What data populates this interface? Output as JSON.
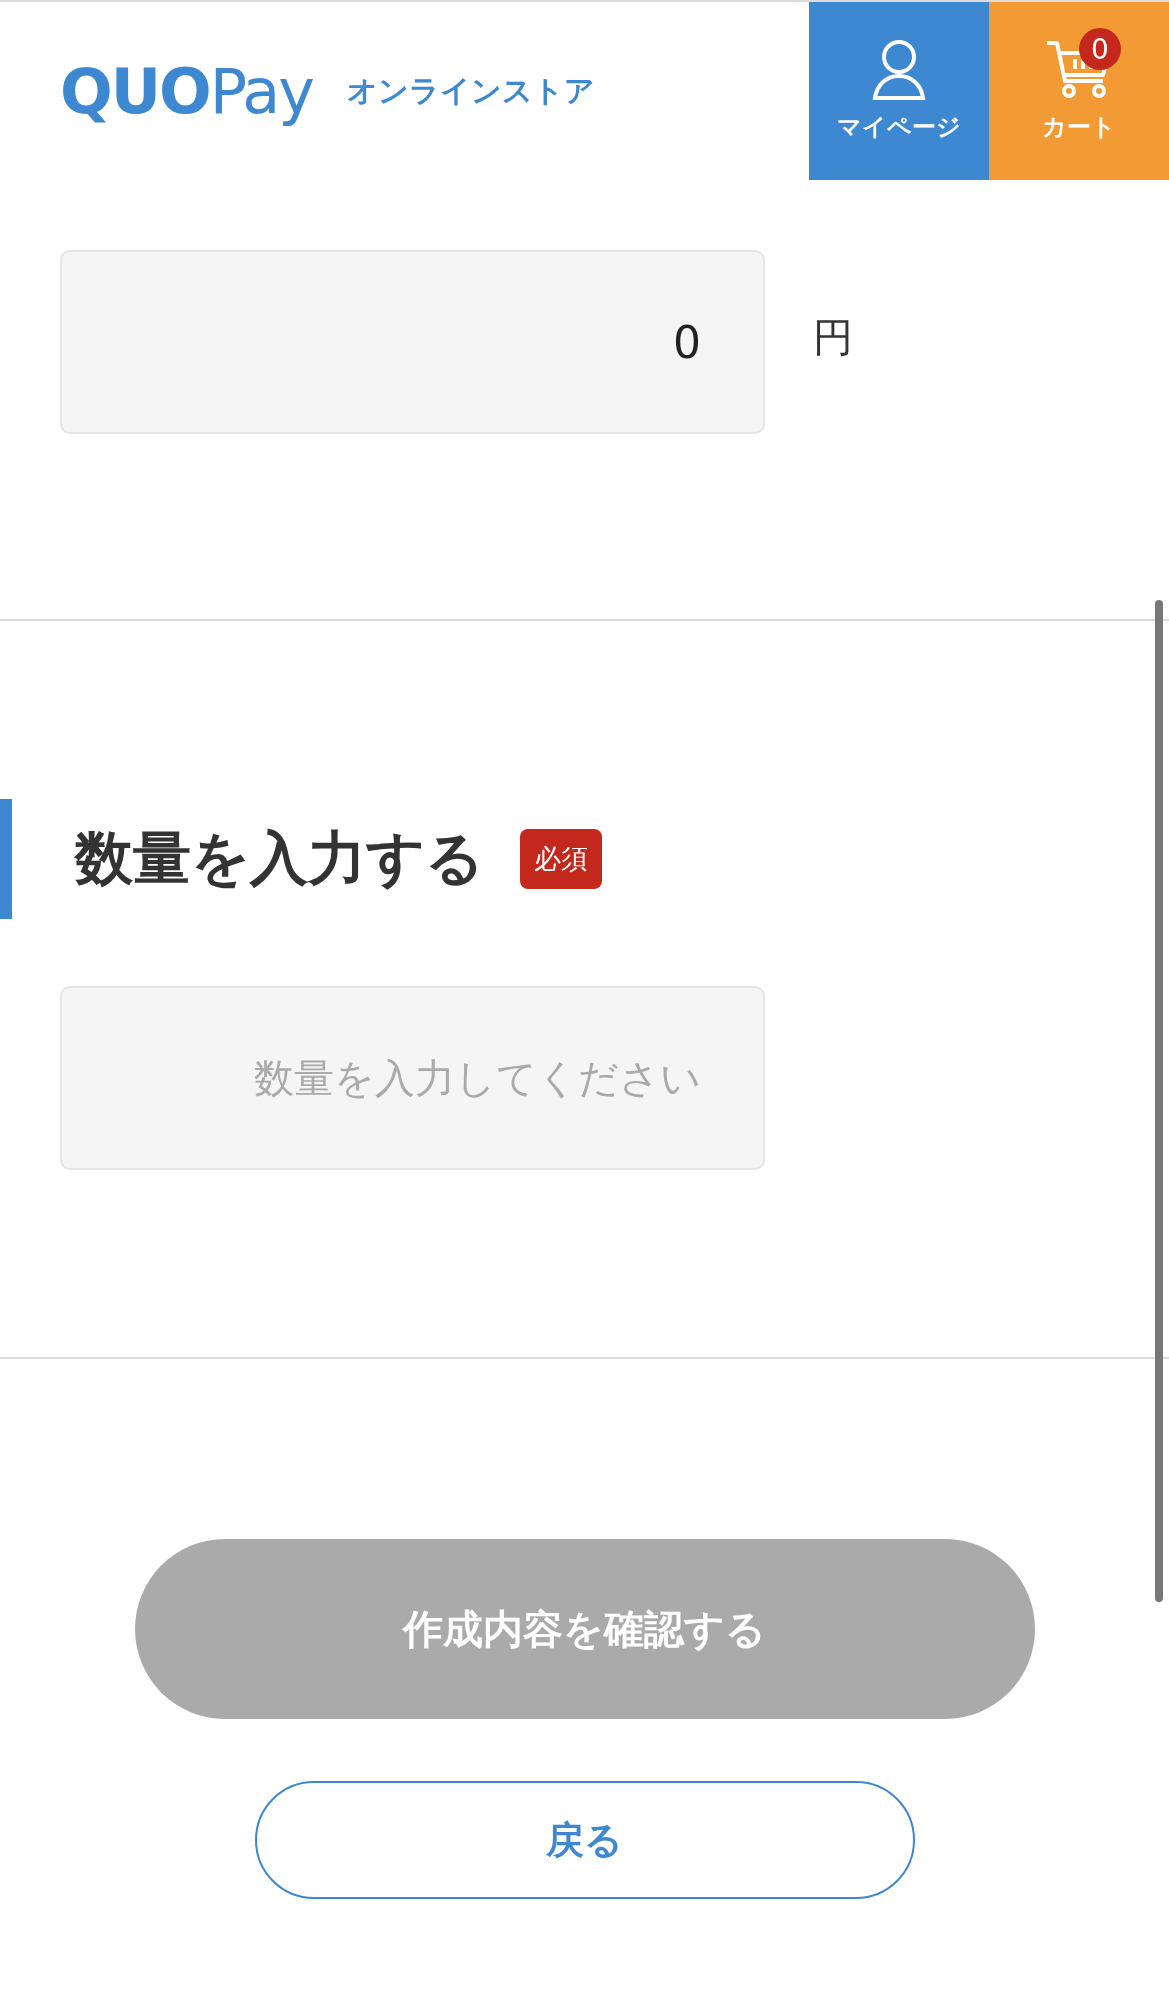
{
  "header": {
    "logo": {
      "brand": "QUO",
      "suffix": "Pay",
      "store": "オンラインストア"
    },
    "nav": [
      {
        "kind": "mypage",
        "label": "マイページ"
      },
      {
        "kind": "cart",
        "label": "カート",
        "count": "0"
      }
    ]
  },
  "amount": {
    "value": "0",
    "unit": "円"
  },
  "quantity": {
    "title": "数量を入力する",
    "badge": "必須",
    "placeholder": "数量を入力してください"
  },
  "buttons": {
    "confirm": {
      "label": "作成内容を確認する",
      "disabled": true
    },
    "back": {
      "label": "戻る"
    }
  }
}
